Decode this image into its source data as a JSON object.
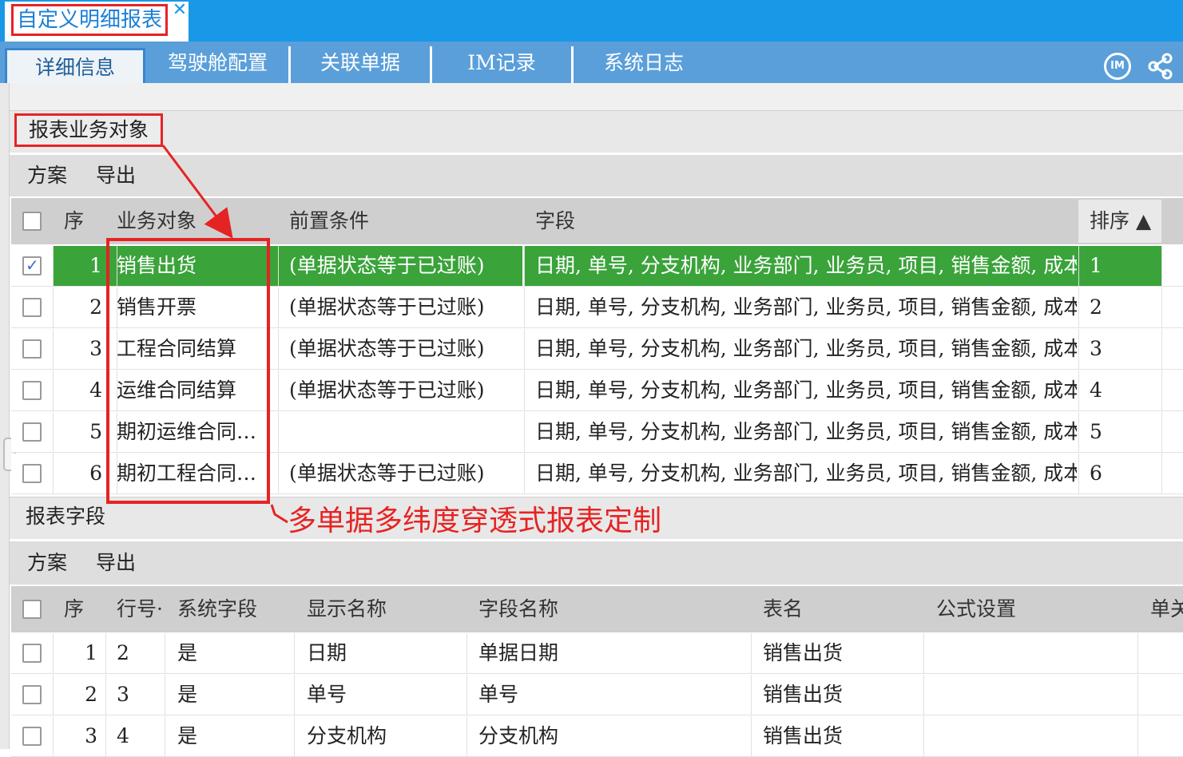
{
  "document_tab": {
    "title": "自定义明细报表",
    "close": "✕"
  },
  "tabs": [
    {
      "label": "详细信息"
    },
    {
      "label": "驾驶舱配置"
    },
    {
      "label": "关联单据"
    },
    {
      "label": "IM记录"
    },
    {
      "label": "系统日志"
    }
  ],
  "header_icons": {
    "im": "IM",
    "share": "share-icon"
  },
  "section1": {
    "title": "报表业务对象",
    "toolbar": {
      "scheme": "方案",
      "export": "导出"
    },
    "columns": {
      "seq": "序",
      "object": "业务对象",
      "condition": "前置条件",
      "fields": "字段",
      "sort": "排序 ▲"
    },
    "rows": [
      {
        "seq": "1",
        "object": "销售出货",
        "condition": "(单据状态等于已过账)",
        "fields": "日期, 单号, 分支机构, 业务部门, 业务员, 项目, 销售金额, 成本",
        "sort": "1",
        "checked": true,
        "selected": true
      },
      {
        "seq": "2",
        "object": "销售开票",
        "condition": "(单据状态等于已过账)",
        "fields": "日期, 单号, 分支机构, 业务部门, 业务员, 项目, 销售金额, 成本",
        "sort": "2",
        "checked": false,
        "selected": false
      },
      {
        "seq": "3",
        "object": "工程合同结算",
        "condition": "(单据状态等于已过账)",
        "fields": "日期, 单号, 分支机构, 业务部门, 业务员, 项目, 销售金额, 成本",
        "sort": "3",
        "checked": false,
        "selected": false
      },
      {
        "seq": "4",
        "object": "运维合同结算",
        "condition": "(单据状态等于已过账)",
        "fields": "日期, 单号, 分支机构, 业务部门, 业务员, 项目, 销售金额, 成本",
        "sort": "4",
        "checked": false,
        "selected": false
      },
      {
        "seq": "5",
        "object": "期初运维合同…",
        "condition": "",
        "fields": "日期, 单号, 分支机构, 业务部门, 业务员, 项目, 销售金额, 成本",
        "sort": "5",
        "checked": false,
        "selected": false
      },
      {
        "seq": "6",
        "object": "期初工程合同…",
        "condition": "(单据状态等于已过账)",
        "fields": "日期, 单号, 分支机构, 业务部门, 业务员, 项目, 销售金额, 成本",
        "sort": "6",
        "checked": false,
        "selected": false
      }
    ]
  },
  "annotation": {
    "text": "多单据多纬度穿透式报表定制"
  },
  "section2": {
    "title": "报表字段",
    "toolbar": {
      "scheme": "方案",
      "export": "导出"
    },
    "columns": {
      "seq": "序",
      "line_no": "行号·",
      "system_field": "系统字段",
      "display_name": "显示名称",
      "field_name": "字段名称",
      "table_name": "表名",
      "formula": "公式设置",
      "single": "单关"
    },
    "rows": [
      {
        "seq": "1",
        "line_no": "2",
        "system_field": "是",
        "display_name": "日期",
        "field_name": "单据日期",
        "table_name": "销售出货",
        "formula": ""
      },
      {
        "seq": "2",
        "line_no": "3",
        "system_field": "是",
        "display_name": "单号",
        "field_name": "单号",
        "table_name": "销售出货",
        "formula": ""
      },
      {
        "seq": "3",
        "line_no": "4",
        "system_field": "是",
        "display_name": "分支机构",
        "field_name": "分支机构",
        "table_name": "销售出货",
        "formula": ""
      }
    ]
  },
  "colors": {
    "accent_blue": "#1a98e8",
    "tab_bar": "#5a9fda",
    "selected_row": "#3aa33a",
    "annotation_red": "#e62323"
  }
}
